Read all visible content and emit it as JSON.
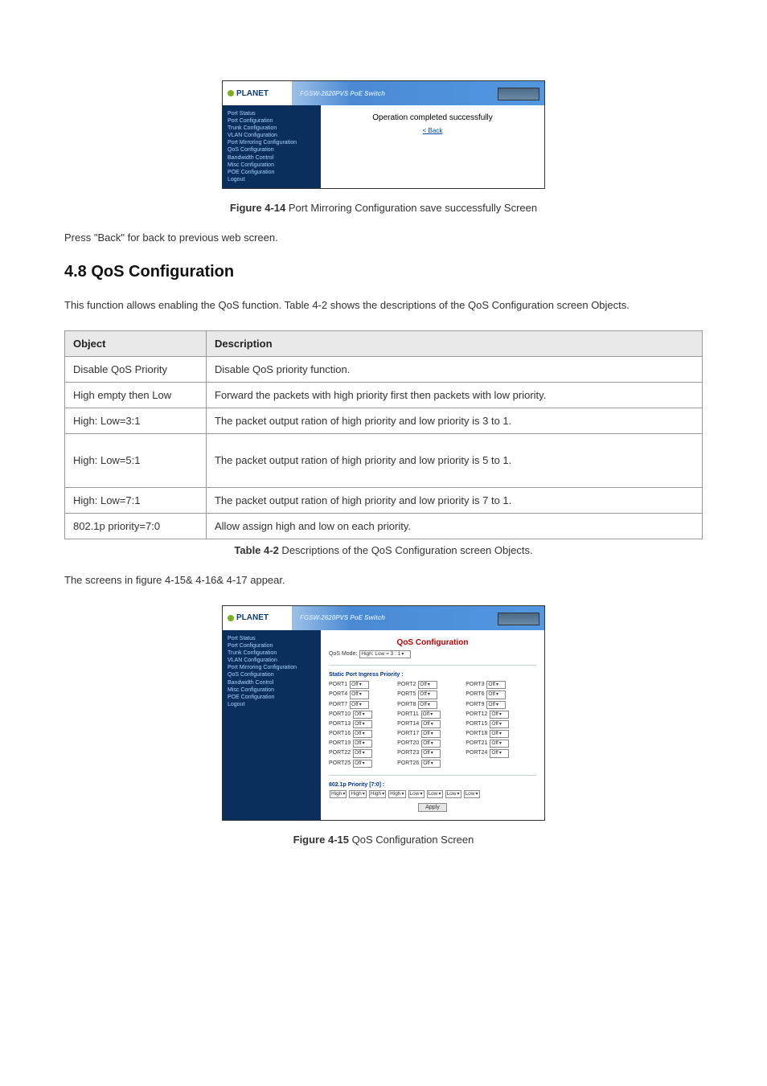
{
  "product_model": "FGSW-2620PVS PoE Switch",
  "brand": "PLANET",
  "nav_items": [
    "Port Status",
    "Port Configuration",
    "Trunk Configuration",
    "VLAN Configuration",
    "Port Mirroring Configuration",
    "QoS Configuration",
    "Bandwidth Control",
    "Misc Configuration",
    "POE Configuration",
    "Logout"
  ],
  "fig414": {
    "msg": "Operation completed successfully",
    "back": "< Back",
    "caption_bold": "Figure 4-14",
    "caption_rest": " Port Mirroring Configuration save successfully Screen"
  },
  "text_press_back": "Press \"Back\" for back to previous web screen.",
  "section_48": "4.8 QoS Configuration",
  "section_intro": "This function allows enabling the QoS function. Table 4-2 shows the descriptions of the QoS Configuration screen Objects.",
  "table_headers": {
    "object": "Object",
    "description": "Description"
  },
  "table_rows": [
    {
      "object": "Disable QoS Priority",
      "description": "Disable QoS priority function."
    },
    {
      "object": "High empty then Low",
      "description": "Forward the packets with high priority first then packets with low priority."
    },
    {
      "object": "High: Low=3:1",
      "description": "The packet output ration of high priority and low priority is 3 to 1."
    },
    {
      "object": "High: Low=5:1",
      "description": "The packet output ration of high priority and low priority is 5 to 1."
    },
    {
      "object": "High: Low=7:1",
      "description": "The packet output ration of high priority and low priority is 7 to 1."
    },
    {
      "object": "802.1p priority=7:0",
      "description": "Allow assign high and low on each priority."
    }
  ],
  "table_caption_bold": "Table 4-2",
  "table_caption_rest": " Descriptions of the QoS Configuration screen Objects.",
  "text_screens_appear": "The screens in figure 4-15& 4-16& 4-17 appear.",
  "fig415": {
    "title": "QoS Configuration",
    "mode_label": "QoS Mode:",
    "mode_value": "High: Low = 3 : 1",
    "static_label": "Static Port Ingress Priority :",
    "ports": [
      {
        "name": "PORT1",
        "val": "Off"
      },
      {
        "name": "PORT2",
        "val": "Off"
      },
      {
        "name": "PORT3",
        "val": "Off"
      },
      {
        "name": "PORT4",
        "val": "Off"
      },
      {
        "name": "PORT5",
        "val": "Off"
      },
      {
        "name": "PORT6",
        "val": "Off"
      },
      {
        "name": "PORT7",
        "val": "Off"
      },
      {
        "name": "PORT8",
        "val": "Off"
      },
      {
        "name": "PORT9",
        "val": "Off"
      },
      {
        "name": "PORT10",
        "val": "Off"
      },
      {
        "name": "PORT11",
        "val": "Off"
      },
      {
        "name": "PORT12",
        "val": "Off"
      },
      {
        "name": "PORT13",
        "val": "Off"
      },
      {
        "name": "PORT14",
        "val": "Off"
      },
      {
        "name": "PORT15",
        "val": "Off"
      },
      {
        "name": "PORT16",
        "val": "Off"
      },
      {
        "name": "PORT17",
        "val": "Off"
      },
      {
        "name": "PORT18",
        "val": "Off"
      },
      {
        "name": "PORT19",
        "val": "Off"
      },
      {
        "name": "PORT20",
        "val": "Off"
      },
      {
        "name": "PORT21",
        "val": "Off"
      },
      {
        "name": "PORT22",
        "val": "Off"
      },
      {
        "name": "PORT23",
        "val": "Off"
      },
      {
        "name": "PORT24",
        "val": "Off"
      },
      {
        "name": "PORT25",
        "val": "Off"
      },
      {
        "name": "PORT26",
        "val": "Off"
      }
    ],
    "dot1p_label": "802.1p Priority [7:0] :",
    "dot1p_values": [
      "High",
      "High",
      "High",
      "High",
      "Low",
      "Low",
      "Low",
      "Low"
    ],
    "apply": "Apply",
    "caption_bold": "Figure 4-15",
    "caption_rest": " QoS Configuration Screen"
  },
  "chart_data": {
    "type": "table",
    "title": "QoS Configuration - Static Port Ingress Priority",
    "mode": "High: Low = 3 : 1",
    "columns": [
      "Port",
      "Priority"
    ],
    "rows": [
      [
        "PORT1",
        "Off"
      ],
      [
        "PORT2",
        "Off"
      ],
      [
        "PORT3",
        "Off"
      ],
      [
        "PORT4",
        "Off"
      ],
      [
        "PORT5",
        "Off"
      ],
      [
        "PORT6",
        "Off"
      ],
      [
        "PORT7",
        "Off"
      ],
      [
        "PORT8",
        "Off"
      ],
      [
        "PORT9",
        "Off"
      ],
      [
        "PORT10",
        "Off"
      ],
      [
        "PORT11",
        "Off"
      ],
      [
        "PORT12",
        "Off"
      ],
      [
        "PORT13",
        "Off"
      ],
      [
        "PORT14",
        "Off"
      ],
      [
        "PORT15",
        "Off"
      ],
      [
        "PORT16",
        "Off"
      ],
      [
        "PORT17",
        "Off"
      ],
      [
        "PORT18",
        "Off"
      ],
      [
        "PORT19",
        "Off"
      ],
      [
        "PORT20",
        "Off"
      ],
      [
        "PORT21",
        "Off"
      ],
      [
        "PORT22",
        "Off"
      ],
      [
        "PORT23",
        "Off"
      ],
      [
        "PORT24",
        "Off"
      ],
      [
        "PORT25",
        "Off"
      ],
      [
        "PORT26",
        "Off"
      ]
    ],
    "dot1p_priority_7_to_0": [
      "High",
      "High",
      "High",
      "High",
      "Low",
      "Low",
      "Low",
      "Low"
    ]
  }
}
